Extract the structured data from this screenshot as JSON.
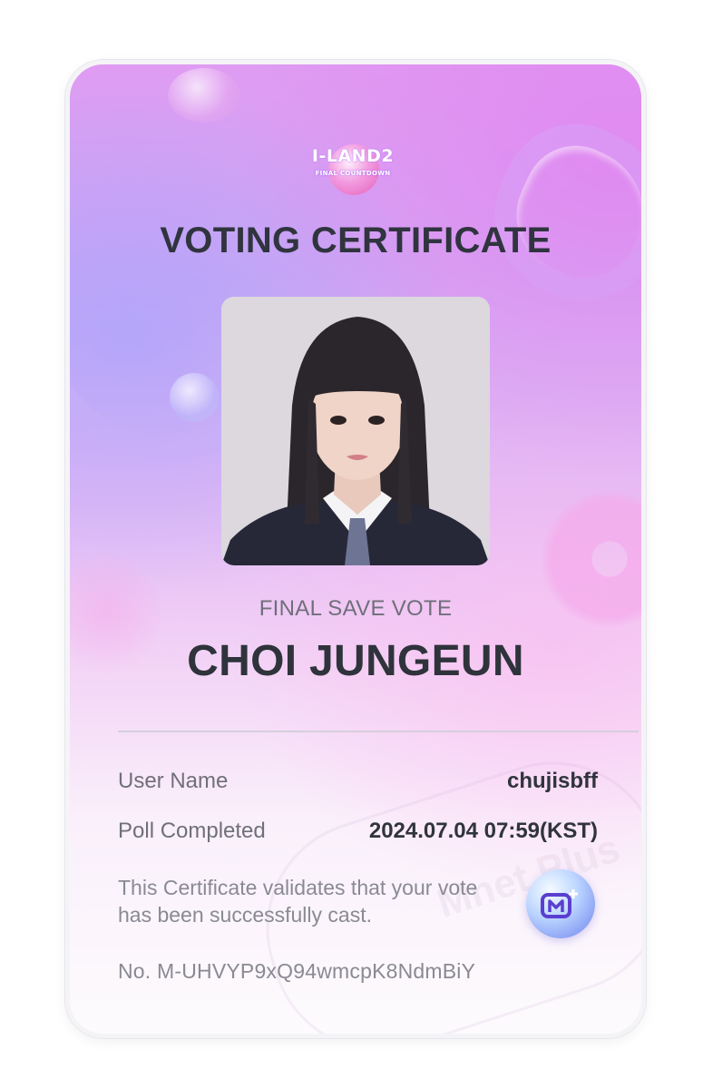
{
  "logo": {
    "title": "I-LAND2",
    "subtitle": "FINAL COUNTDOWN"
  },
  "certificate": {
    "title": "VOTING CERTIFICATE",
    "vote_type": "FINAL SAVE VOTE",
    "candidate_name": "CHOI JUNGEUN"
  },
  "details": [
    {
      "label": "User Name",
      "value": "chujisbff"
    },
    {
      "label": "Poll Completed",
      "value": "2024.07.04 07:59(KST)"
    }
  ],
  "note": "This Certificate validates that your vote has been successfully cast.",
  "certificate_no": "No. M-UHVYP9xQ94wmcpK8NdmBiY",
  "watermark": "Mnet Plus",
  "colors": {
    "card_top": "#df9cf2",
    "card_bottom": "#fdfbfd",
    "title_text": "#30343f",
    "muted_text": "#70707a"
  }
}
